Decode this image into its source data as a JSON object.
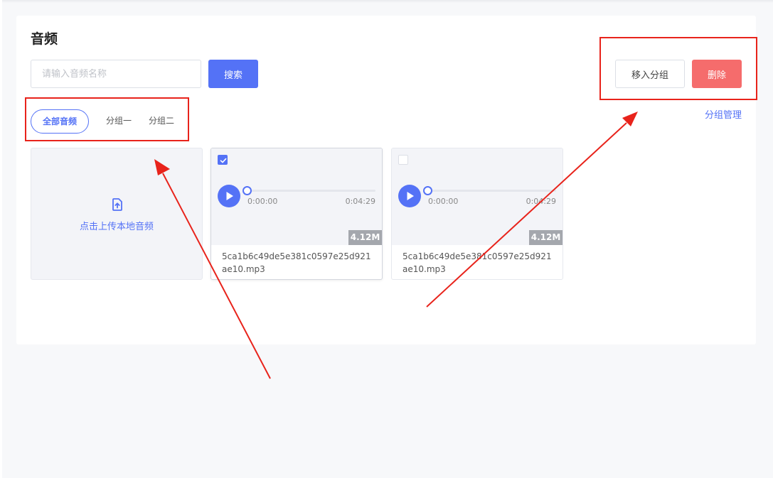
{
  "page": {
    "title": "音频"
  },
  "search": {
    "placeholder": "请输入音频名称",
    "value": "",
    "button_label": "搜索"
  },
  "actions": {
    "move_label": "移入分组",
    "delete_label": "删除",
    "group_manage_label": "分组管理"
  },
  "tabs": [
    {
      "label": "全部音频",
      "active": true
    },
    {
      "label": "分组一",
      "active": false
    },
    {
      "label": "分组二",
      "active": false
    }
  ],
  "upload": {
    "label": "点击上传本地音频",
    "icon": "upload-icon"
  },
  "audio_files": [
    {
      "checked": true,
      "current_time": "0:00:00",
      "duration": "0:04:29",
      "size": "4.12M",
      "name": "5ca1b6c49de5e381c0597e25d921ae10.mp3"
    },
    {
      "checked": false,
      "current_time": "0:00:00",
      "duration": "0:04:29",
      "size": "4.12M",
      "name": "5ca1b6c49de5e381c0597e25d921ae10.mp3"
    }
  ],
  "colors": {
    "primary": "#5472f6",
    "danger": "#f56c6c",
    "annotation": "#e8231b",
    "background": "#f7f8fa"
  }
}
